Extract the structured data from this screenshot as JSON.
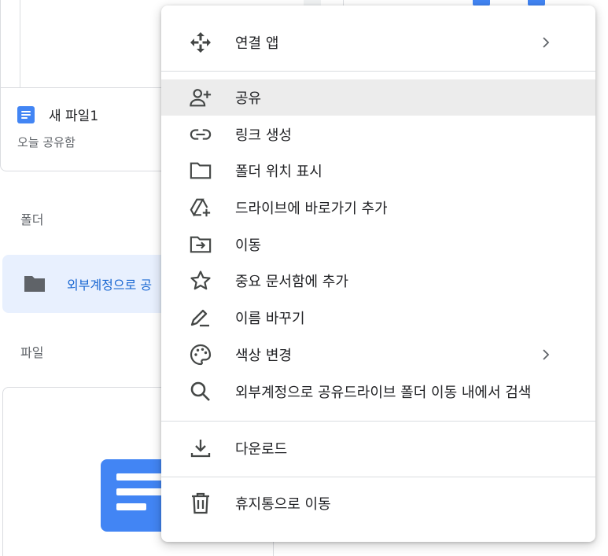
{
  "background": {
    "doc_card": {
      "title": "새 파일1",
      "subtitle": "오늘 공유함"
    },
    "sections": {
      "folders": "폴더",
      "files": "파일"
    },
    "folder_chip": {
      "name": "외부계정으로 공"
    }
  },
  "menu": {
    "items": [
      {
        "label": "연결 앱",
        "icon": "move-arrows-icon",
        "submenu": true
      },
      {
        "label": "공유",
        "icon": "person-add-icon",
        "highlighted": true
      },
      {
        "label": "링크 생성",
        "icon": "link-icon"
      },
      {
        "label": "폴더 위치 표시",
        "icon": "folder-outline-icon"
      },
      {
        "label": "드라이브에 바로가기 추가",
        "icon": "drive-add-shortcut-icon"
      },
      {
        "label": "이동",
        "icon": "move-to-folder-icon"
      },
      {
        "label": "중요 문서함에 추가",
        "icon": "star-icon"
      },
      {
        "label": "이름 바꾸기",
        "icon": "rename-pen-icon"
      },
      {
        "label": "색상 변경",
        "icon": "palette-icon",
        "submenu": true
      },
      {
        "label": "외부계정으로 공유드라이브 폴더 이동 내에서 검색",
        "icon": "search-icon"
      },
      {
        "label": "다운로드",
        "icon": "download-icon"
      },
      {
        "label": "휴지통으로 이동",
        "icon": "trash-icon"
      }
    ]
  },
  "colors": {
    "accent_blue": "#4285f4",
    "link_blue": "#1967d2",
    "highlight_bg": "#ececec",
    "selected_chip_bg": "#e8f0fe",
    "icon_gray": "#444746"
  }
}
